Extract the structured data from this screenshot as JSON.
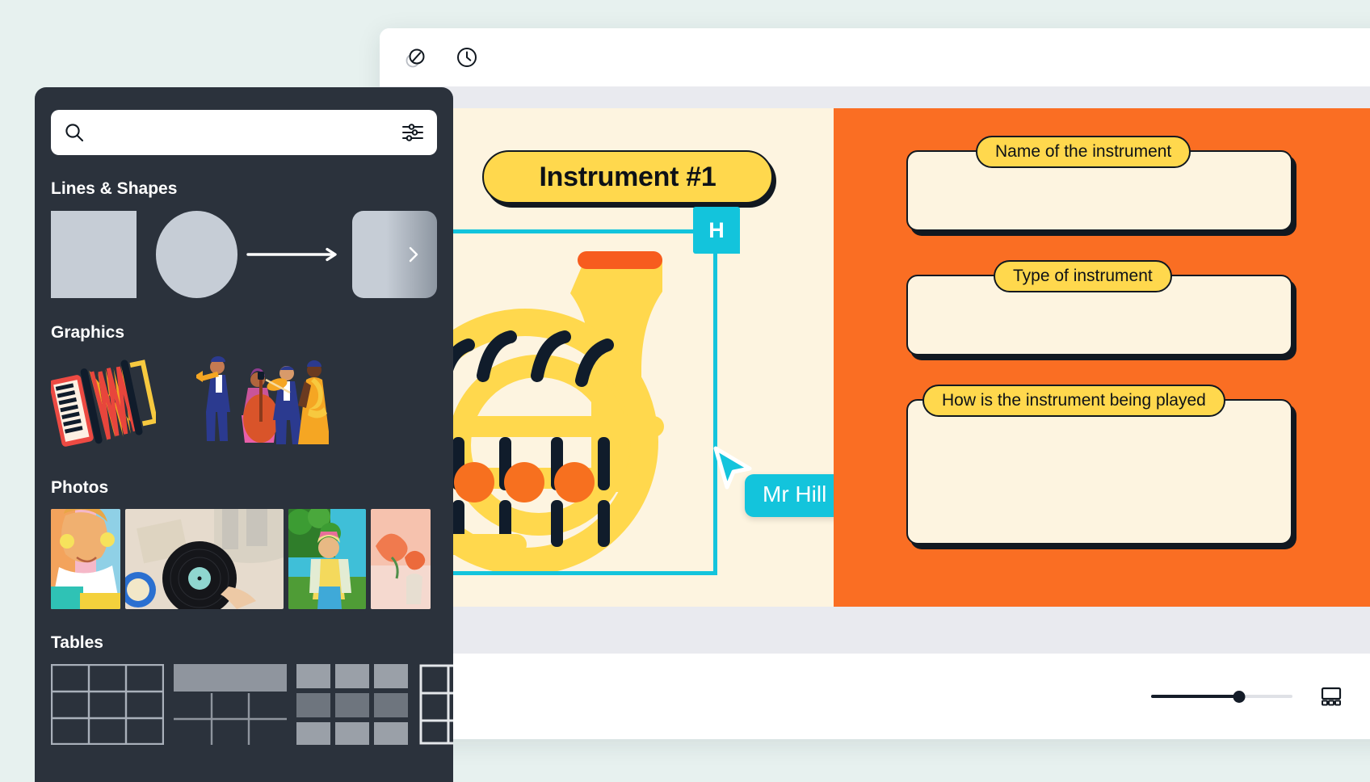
{
  "colors": {
    "page_bg": "#e7f1ef",
    "panel_bg": "#2b323c",
    "canvas_cream": "#fdf4e0",
    "accent_orange": "#fa6e23",
    "accent_yellow": "#ffd84d",
    "accent_cyan": "#13c4dc",
    "ink": "#111820"
  },
  "toolbar": {
    "duplicate_label": "duplicate-icon",
    "history_label": "history-clock-icon"
  },
  "slide": {
    "title": "Instrument #1",
    "fields": [
      {
        "label": "Name of the instrument",
        "value": ""
      },
      {
        "label": "Type of instrument",
        "value": ""
      },
      {
        "label": "How is the instrument being played",
        "value": ""
      }
    ],
    "collaborator": {
      "name": "Mr Hill",
      "initial": "H"
    }
  },
  "bottom_bar": {
    "zoom_percent": 62,
    "grid_view_label": "slides-grid-icon",
    "fullscreen_label": "present-fullscreen-icon"
  },
  "side_panel": {
    "search": {
      "value": "",
      "placeholder": "",
      "search_icon": "search-icon",
      "filter_icon": "sliders-filter-icon"
    },
    "sections": [
      {
        "title": "Lines & Shapes",
        "items": [
          {
            "name": "square-shape"
          },
          {
            "name": "circle-shape"
          },
          {
            "name": "arrow-line-shape"
          },
          {
            "name": "rounded-rect-shape"
          }
        ],
        "next_icon": "chevron-right-icon"
      },
      {
        "title": "Graphics",
        "items": [
          {
            "name": "accordion-graphic"
          },
          {
            "name": "musicians-band-graphic"
          }
        ]
      },
      {
        "title": "Photos",
        "items": [
          {
            "name": "photo-woman-earrings"
          },
          {
            "name": "photo-vinyl-record"
          },
          {
            "name": "photo-woman-outdoors"
          },
          {
            "name": "photo-peach-flowers"
          }
        ]
      },
      {
        "title": "Tables",
        "items": [
          {
            "name": "table-plain-grid"
          },
          {
            "name": "table-header-row"
          },
          {
            "name": "table-striped"
          },
          {
            "name": "table-outline"
          }
        ]
      }
    ]
  }
}
